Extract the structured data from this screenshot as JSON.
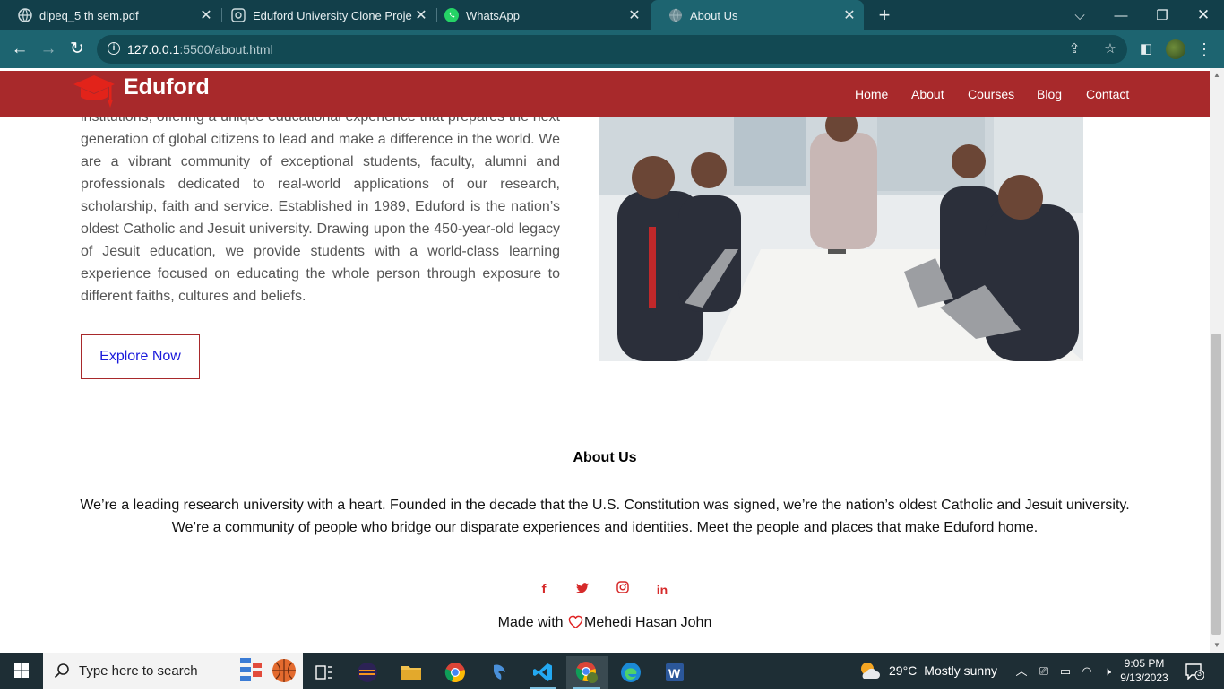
{
  "browser": {
    "tabs": [
      {
        "title": "dipeq_5 th sem.pdf",
        "active": false
      },
      {
        "title": "Eduford University Clone Project",
        "active": false
      },
      {
        "title": "WhatsApp",
        "active": false
      },
      {
        "title": "About Us",
        "active": true
      }
    ],
    "url_host": "127.0.0.1",
    "url_rest": ":5500/about.html"
  },
  "site": {
    "brand": "Eduford",
    "brand_color": "#a8292b",
    "nav": [
      "Home",
      "About",
      "Courses",
      "Blog",
      "Contact"
    ]
  },
  "intro": {
    "text": "institutions, offering a unique educational experience that prepares the next generation of global citizens to lead and make a difference in the world. We are a vibrant community of exceptional students, faculty, alumni and professionals dedicated to real-world applications of our research, scholarship, faith and service. Established in 1989, Eduford is the nation’s oldest Catholic and Jesuit university. Drawing upon the 450-year-old legacy of Jesuit education, we provide students with a world-class learning experience focused on educating the whole person through exposure to different faiths, cultures and beliefs.",
    "button": "Explore Now"
  },
  "about": {
    "title": "About Us",
    "text": "We’re a leading research university with a heart. Founded in the decade that the U.S. Constitution was signed, we’re the nation’s oldest Catholic and Jesuit university. We’re a community of people who bridge our disparate experiences and identities. Meet the people and places that make Eduford home."
  },
  "footer": {
    "socials": [
      "facebook-icon",
      "twitter-icon",
      "instagram-icon",
      "linkedin-icon"
    ],
    "made_with": "Made with",
    "author": "Mehedi Hasan John"
  },
  "taskbar": {
    "search_placeholder": "Type here to search",
    "weather_temp": "29°C",
    "weather_text": "Mostly sunny",
    "time": "9:05 PM",
    "date": "9/13/2023",
    "notifications": "3"
  }
}
